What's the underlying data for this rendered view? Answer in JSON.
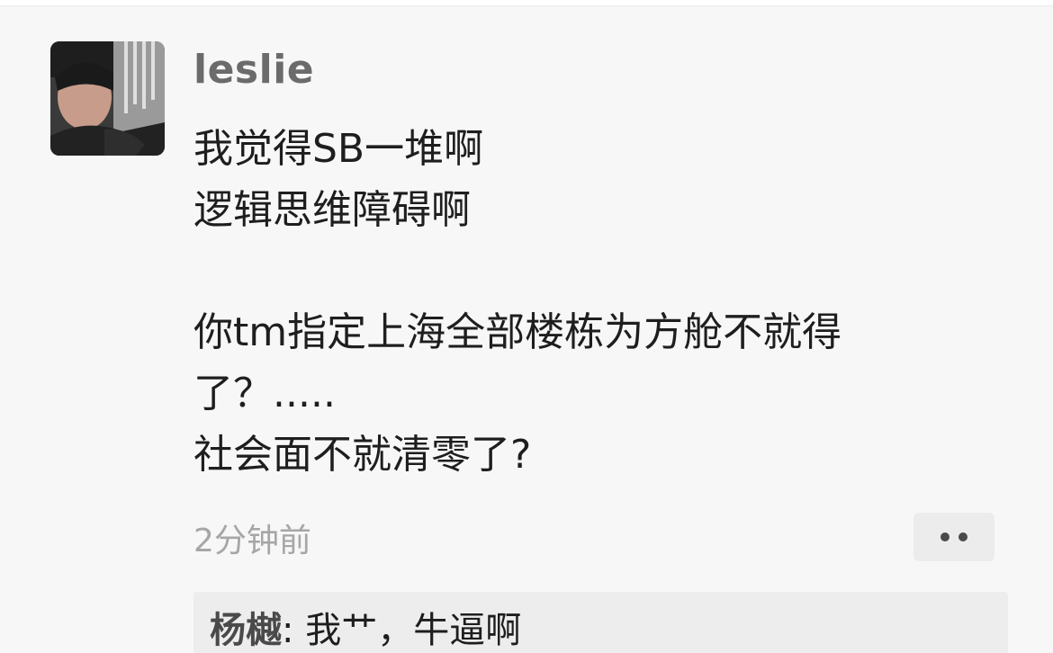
{
  "post": {
    "username": "leslie",
    "lines": [
      "我觉得SB一堆啊",
      "逻辑思维障碍啊",
      "",
      "你tm指定上海全部楼栋为方舱不就得",
      "了？.....",
      "社会面不就清零了?"
    ],
    "timestamp": "2分钟前"
  },
  "reply": {
    "author": "杨樾",
    "separator": ": ",
    "text": "我艹，牛逼啊"
  },
  "icons": {
    "more": "more-dots-icon",
    "avatar": "user-avatar"
  }
}
